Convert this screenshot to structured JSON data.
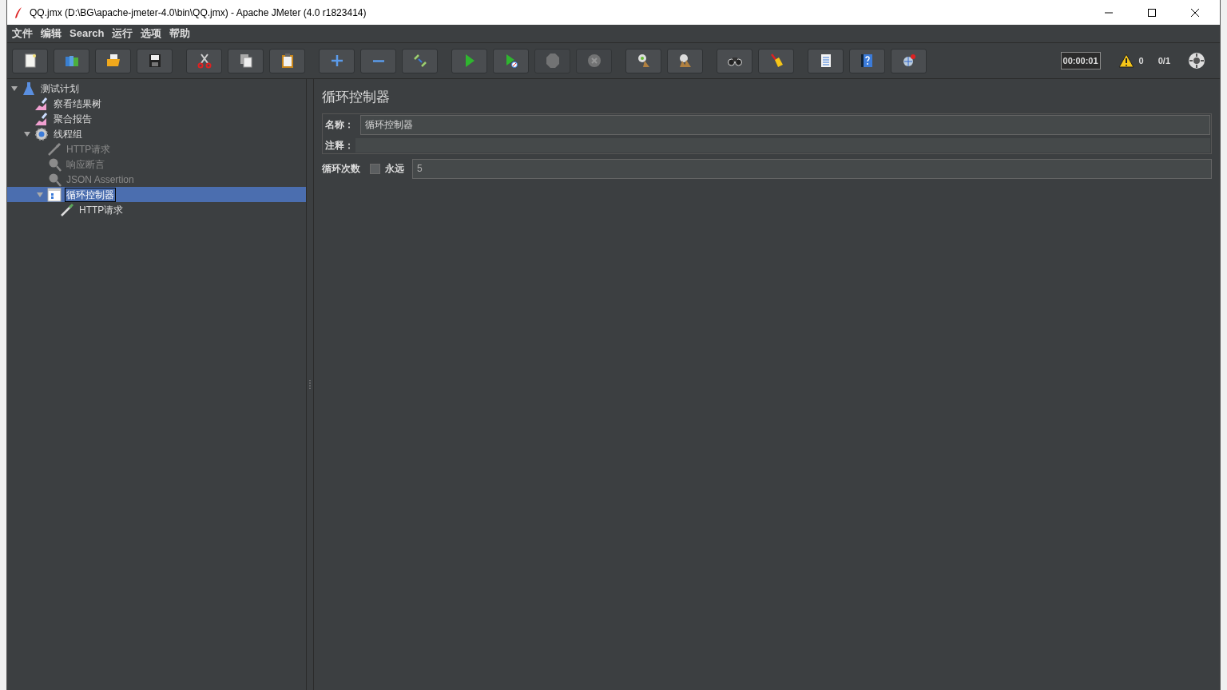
{
  "window": {
    "title": "QQ.jmx (D:\\BG\\apache-jmeter-4.0\\bin\\QQ.jmx) - Apache JMeter (4.0 r1823414)"
  },
  "menu": [
    "文件",
    "编辑",
    "Search",
    "运行",
    "选项",
    "帮助"
  ],
  "toolbar": {
    "groups": [
      [
        {
          "kind": "new",
          "disabled": false
        },
        {
          "kind": "templates",
          "disabled": false
        },
        {
          "kind": "open",
          "disabled": false
        },
        {
          "kind": "save",
          "disabled": false
        }
      ],
      [
        {
          "kind": "cut",
          "disabled": false
        },
        {
          "kind": "copy",
          "disabled": false
        },
        {
          "kind": "paste",
          "disabled": false
        }
      ],
      [
        {
          "kind": "expand",
          "disabled": false
        },
        {
          "kind": "collapse",
          "disabled": false
        },
        {
          "kind": "toggle",
          "disabled": false
        }
      ],
      [
        {
          "kind": "start",
          "disabled": false
        },
        {
          "kind": "start-no-pause",
          "disabled": false
        },
        {
          "kind": "stop",
          "disabled": true
        },
        {
          "kind": "shutdown",
          "disabled": true
        }
      ],
      [
        {
          "kind": "clear",
          "disabled": false
        },
        {
          "kind": "clear-all",
          "disabled": false
        }
      ],
      [
        {
          "kind": "search",
          "disabled": false
        },
        {
          "kind": "reset",
          "disabled": false
        }
      ],
      [
        {
          "kind": "functions",
          "disabled": false
        },
        {
          "kind": "help",
          "disabled": false
        },
        {
          "kind": "remote",
          "disabled": false
        }
      ]
    ],
    "timer": "00:00:01",
    "warnings": "0",
    "threads": "0/1"
  },
  "tree": [
    {
      "label": "测试计划",
      "kind": "plan",
      "expanded": true,
      "selected": false,
      "disabled": false,
      "children": [
        {
          "label": "察看结果树",
          "kind": "listener",
          "selected": false,
          "disabled": false
        },
        {
          "label": "聚合报告",
          "kind": "listener",
          "selected": false,
          "disabled": false
        },
        {
          "label": "线程组",
          "kind": "threads",
          "expanded": true,
          "selected": false,
          "disabled": false,
          "children": [
            {
              "label": "HTTP请求",
              "kind": "sampler",
              "selected": false,
              "disabled": true
            },
            {
              "label": "响应断言",
              "kind": "assertion",
              "selected": false,
              "disabled": true
            },
            {
              "label": "JSON Assertion",
              "kind": "assertion",
              "selected": false,
              "disabled": true
            },
            {
              "label": "循环控制器",
              "kind": "controller",
              "expanded": true,
              "selected": true,
              "disabled": false,
              "children": [
                {
                  "label": "HTTP请求",
                  "kind": "sampler",
                  "selected": false,
                  "disabled": false
                }
              ]
            }
          ]
        }
      ]
    }
  ],
  "form": {
    "title": "循环控制器",
    "name": {
      "label": "名称：",
      "value": "循环控制器"
    },
    "comment": {
      "label": "注释："
    },
    "loops": {
      "label": "循环次数",
      "forever": {
        "label": "永远",
        "checked": false
      },
      "value": "5"
    }
  }
}
